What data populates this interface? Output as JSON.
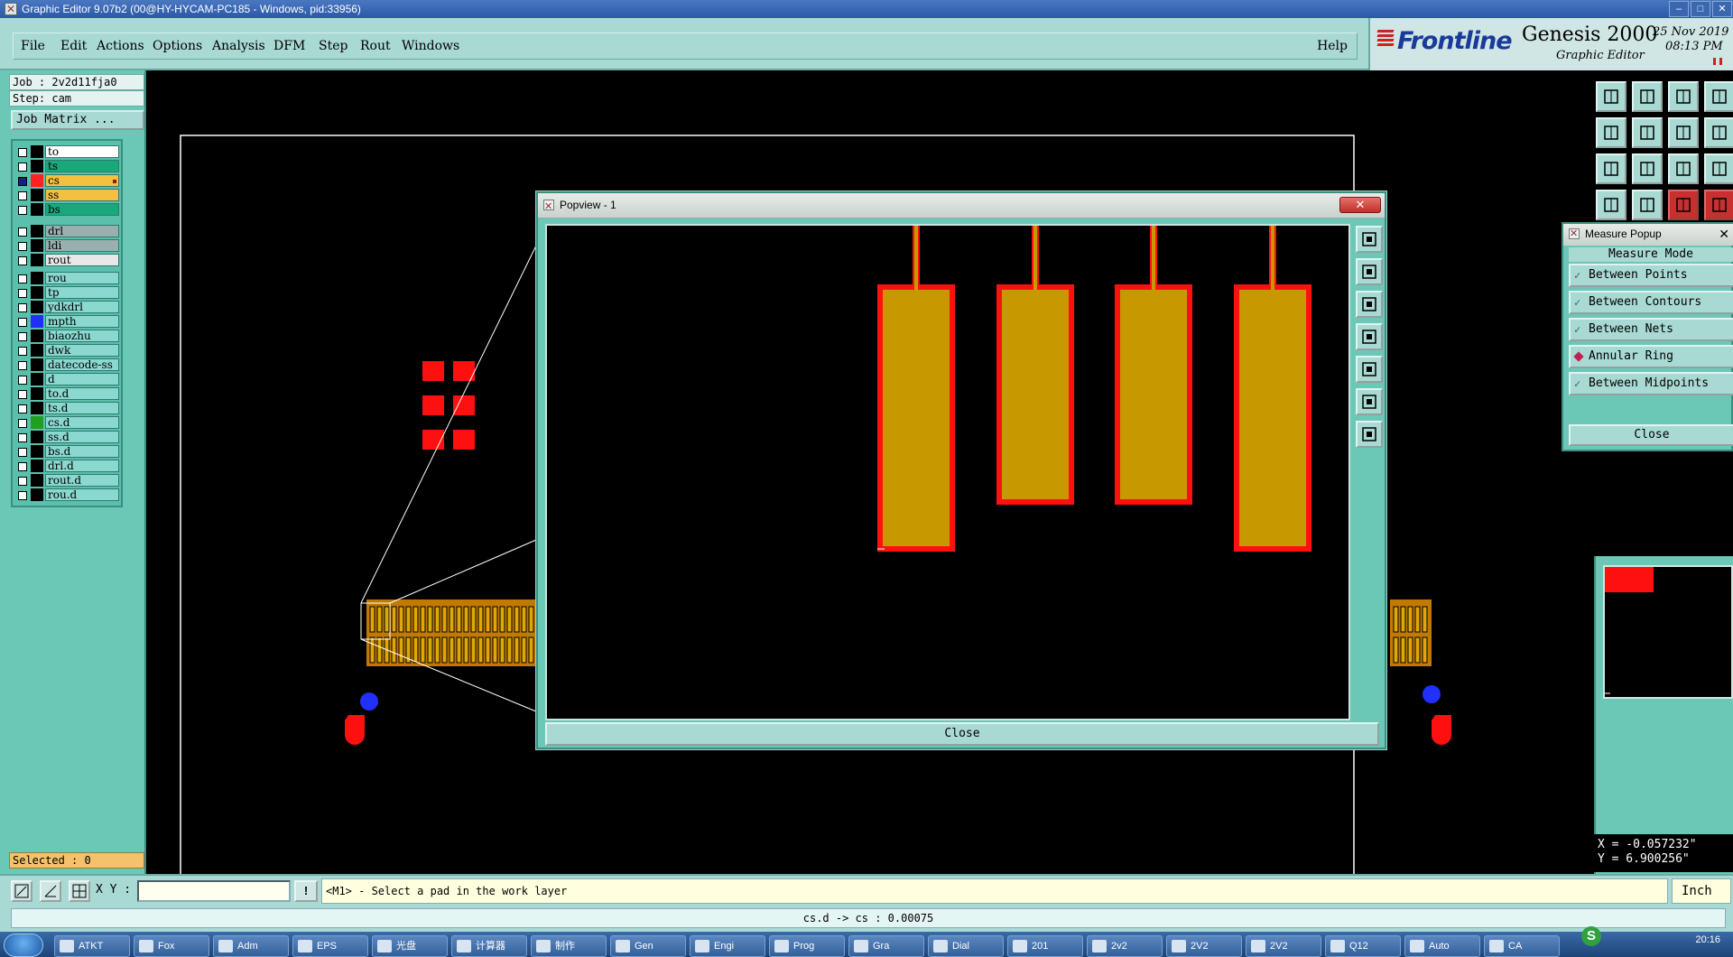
{
  "window": {
    "title": "Graphic Editor 9.07b2 (00@HY-HYCAM-PC185 - Windows, pid:33956)"
  },
  "menu": [
    "File",
    "Edit",
    "Actions",
    "Options",
    "Analysis",
    "DFM",
    "Step",
    "Rout",
    "Windows"
  ],
  "help": "Help",
  "brand": {
    "logo": "Frontline",
    "product": "Genesis 2000",
    "subtitle": "Graphic Editor",
    "date": "25 Nov 2019",
    "time": "08:13 PM"
  },
  "job": {
    "job_label": "Job : 2v2d11fja0",
    "step_label": "Step: cam",
    "matrix_button": "Job Matrix ..."
  },
  "layers": {
    "group1": [
      {
        "name": "to",
        "swatch": "#000000",
        "bg": "#ffffff"
      },
      {
        "name": "ts",
        "swatch": "#000000",
        "bg": "#1aa87a"
      },
      {
        "name": "cs",
        "swatch": "#ff2020",
        "bg": "#f4c040",
        "active": true
      },
      {
        "name": "ss",
        "swatch": "#000000",
        "bg": "#f4c040"
      },
      {
        "name": "bs",
        "swatch": "#000000",
        "bg": "#1aa87a"
      }
    ],
    "group2": [
      {
        "name": "drl",
        "swatch": "#000000",
        "bg": "#9ab0b0"
      },
      {
        "name": "ldi",
        "swatch": "#000000",
        "bg": "#9ab0b0"
      },
      {
        "name": "rout",
        "swatch": "#000000",
        "bg": "#e8e8e8"
      }
    ],
    "group3": [
      {
        "name": "rou",
        "swatch": "#000000",
        "bg": "#8ad8d0"
      },
      {
        "name": "tp",
        "swatch": "#000000",
        "bg": "#8ad8d0"
      },
      {
        "name": "ydkdrl",
        "swatch": "#000000",
        "bg": "#8ad8d0"
      },
      {
        "name": "mpth",
        "swatch": "#2030ff",
        "bg": "#8ad8d0"
      },
      {
        "name": "biaozhu",
        "swatch": "#000000",
        "bg": "#8ad8d0"
      },
      {
        "name": "dwk",
        "swatch": "#000000",
        "bg": "#8ad8d0"
      },
      {
        "name": "datecode-ss",
        "swatch": "#000000",
        "bg": "#8ad8d0"
      },
      {
        "name": "d",
        "swatch": "#000000",
        "bg": "#8ad8d0"
      },
      {
        "name": "to.d",
        "swatch": "#000000",
        "bg": "#8ad8d0"
      },
      {
        "name": "ts.d",
        "swatch": "#000000",
        "bg": "#8ad8d0"
      },
      {
        "name": "cs.d",
        "swatch": "#20a020",
        "bg": "#8ad8d0"
      },
      {
        "name": "ss.d",
        "swatch": "#000000",
        "bg": "#8ad8d0"
      },
      {
        "name": "bs.d",
        "swatch": "#000000",
        "bg": "#8ad8d0"
      },
      {
        "name": "drl.d",
        "swatch": "#000000",
        "bg": "#8ad8d0"
      },
      {
        "name": "rout.d",
        "swatch": "#000000",
        "bg": "#8ad8d0"
      },
      {
        "name": "rou.d",
        "swatch": "#000000",
        "bg": "#8ad8d0"
      }
    ]
  },
  "selected": "Selected : 0",
  "popview": {
    "title": "Popview - 1",
    "close": "Close"
  },
  "measure": {
    "title": "Measure Popup",
    "mode_label": "Measure Mode",
    "options": [
      {
        "label": "Between Points",
        "mark": "check"
      },
      {
        "label": "Between Contours",
        "mark": "check"
      },
      {
        "label": "Between Nets",
        "mark": "check"
      },
      {
        "label": "Annular Ring",
        "mark": "diamond"
      },
      {
        "label": "Between Midpoints",
        "mark": "check"
      }
    ],
    "close": "Close"
  },
  "coords": {
    "x": "X = -0.057232\"",
    "y": "Y = 6.900256\""
  },
  "cmd": {
    "xy_label": "X Y :",
    "xy_value": "",
    "toggle": "!",
    "prompt": "<M1> - Select a pad in the work layer",
    "unit": "Inch"
  },
  "status": "cs.d -> cs : 0.00075",
  "taskbar": [
    "ATKT",
    "Fox",
    "Adm",
    "EPS",
    "光盘",
    "计算器",
    "制作",
    "Gen",
    "Engi",
    "Prog",
    "Gra",
    "Dial",
    "201",
    "2v2",
    "2V2",
    "2V2",
    "Q12",
    "Auto",
    "CA"
  ],
  "clock": "20:16",
  "colors": {
    "copper": "#c89800",
    "pad_red": "#ff1010",
    "panel": "#6cc8b6",
    "menu": "#a9d9d3"
  }
}
